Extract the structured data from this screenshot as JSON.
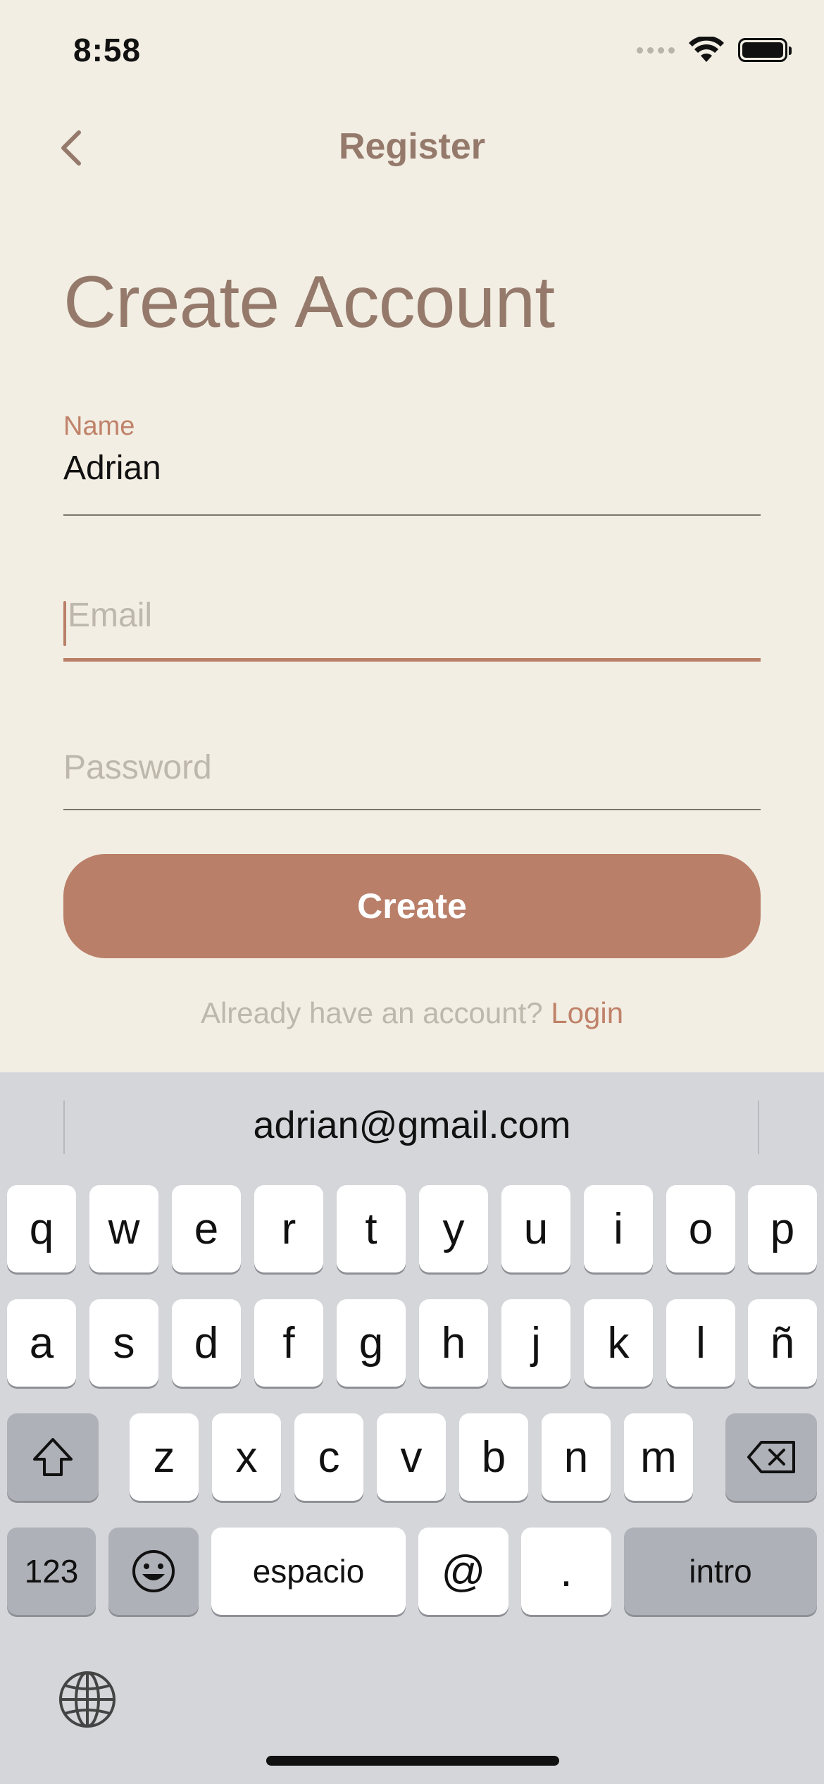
{
  "status_bar": {
    "time": "8:58"
  },
  "nav": {
    "title": "Register"
  },
  "page": {
    "title": "Create Account"
  },
  "form": {
    "name": {
      "label": "Name",
      "value": "Adrian"
    },
    "email": {
      "placeholder": "Email"
    },
    "password": {
      "placeholder": "Password"
    },
    "submit_label": "Create",
    "login_prompt": "Already have an account?",
    "login_link": "Login"
  },
  "keyboard": {
    "suggestion": "adrian@gmail.com",
    "row1": [
      "q",
      "w",
      "e",
      "r",
      "t",
      "y",
      "u",
      "i",
      "o",
      "p"
    ],
    "row2": [
      "a",
      "s",
      "d",
      "f",
      "g",
      "h",
      "j",
      "k",
      "l",
      "ñ"
    ],
    "row3": [
      "z",
      "x",
      "c",
      "v",
      "b",
      "n",
      "m"
    ],
    "numbers_label": "123",
    "space_label": "espacio",
    "at_label": "@",
    "dot_label": ".",
    "return_label": "intro"
  },
  "colors": {
    "background": "#F2EEE3",
    "accent": "#B97F69",
    "title": "#957A6C",
    "keyboard_bg": "#D5D6DA"
  },
  "icons": [
    "back-chevron-icon",
    "signal-icon",
    "wifi-icon",
    "battery-icon",
    "shift-icon",
    "delete-icon",
    "emoji-icon",
    "globe-icon"
  ]
}
